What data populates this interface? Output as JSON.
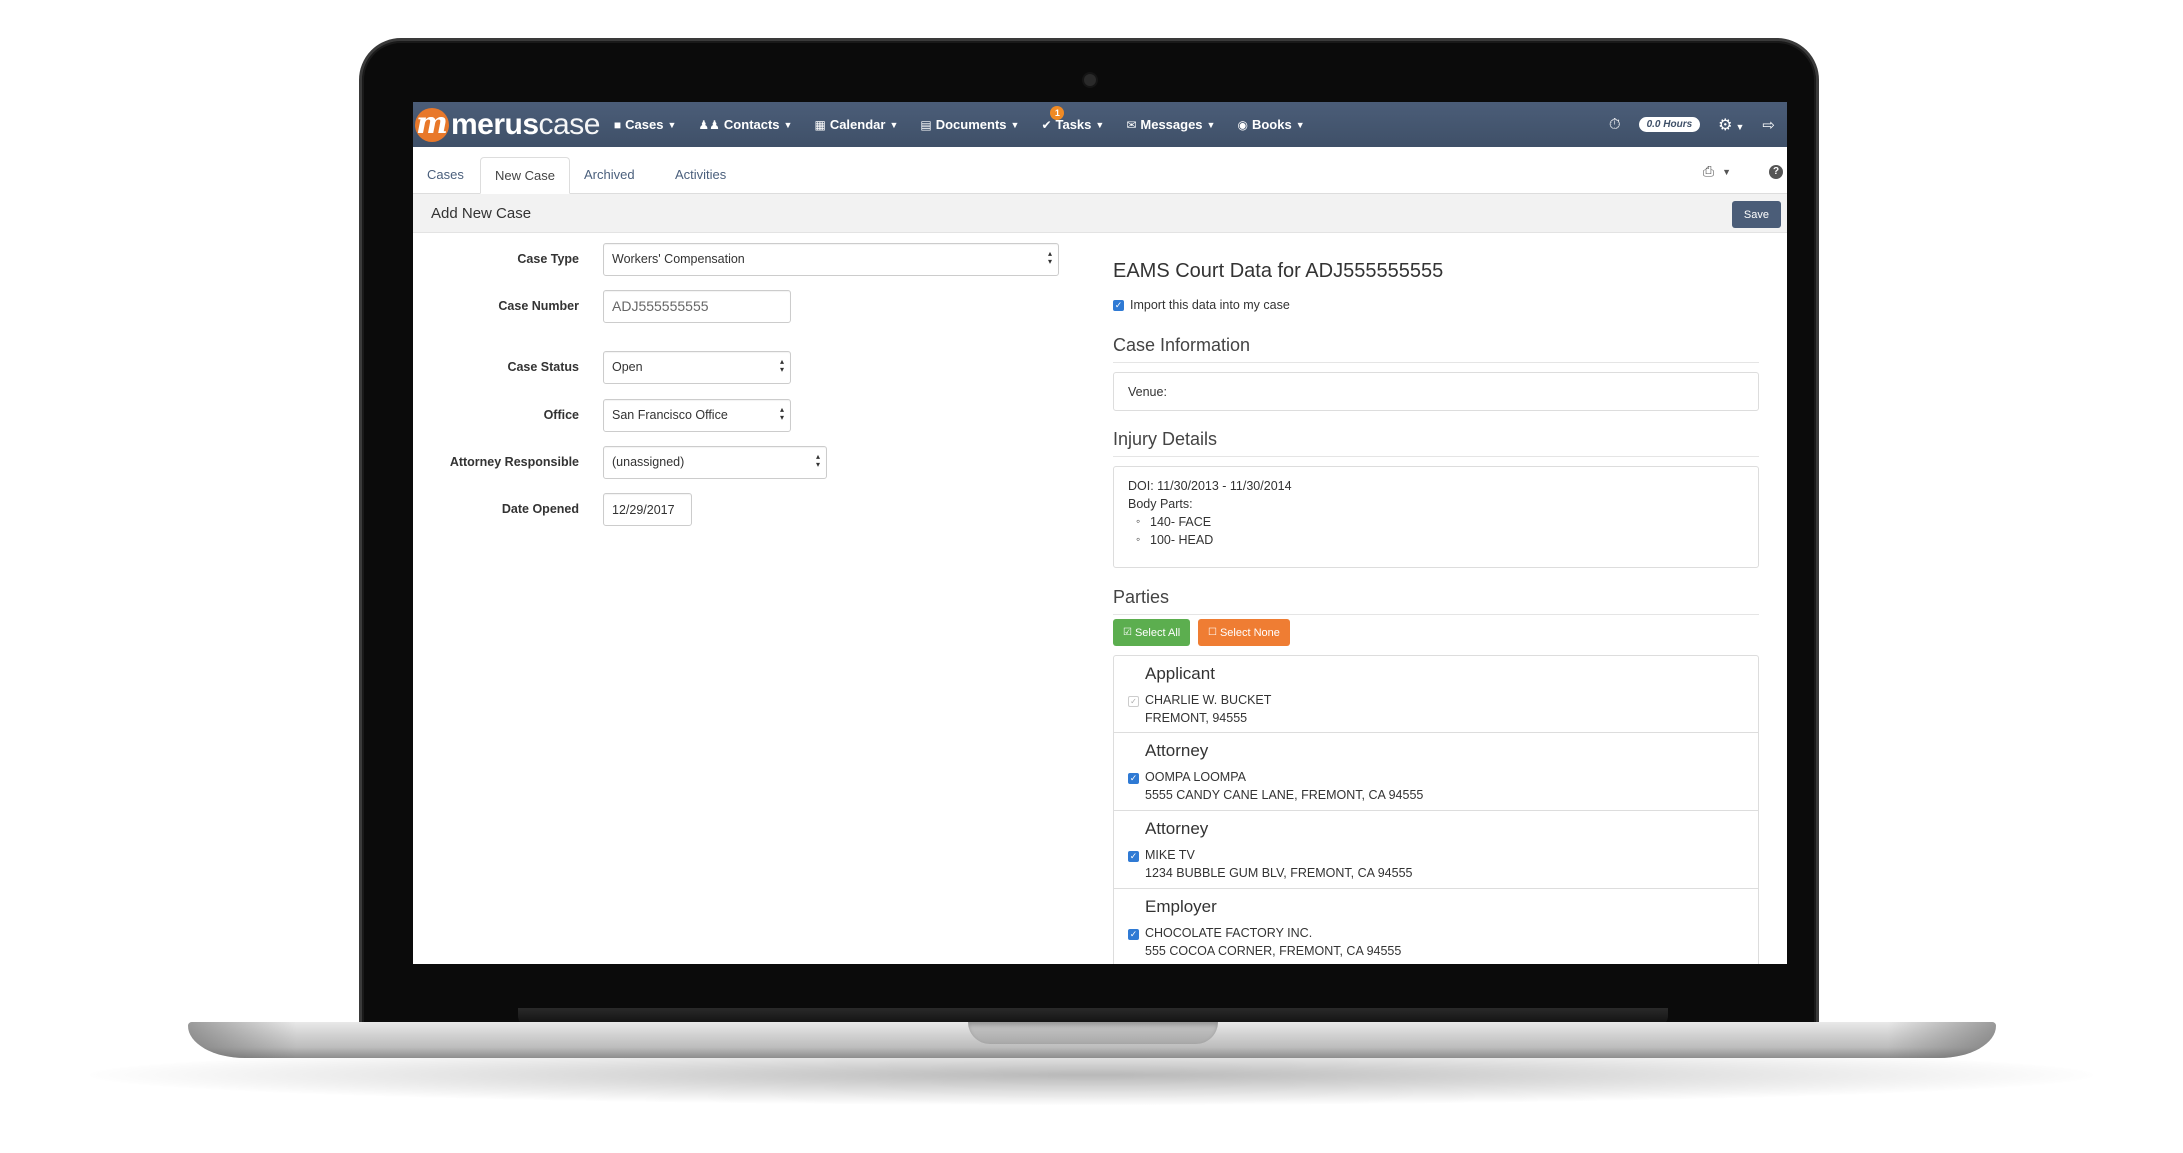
{
  "app": {
    "brand_part1": "merus",
    "brand_part2": "case",
    "accent_color": "#e8782a",
    "nav_color": "#4b5d78"
  },
  "nav": {
    "items": [
      {
        "label": "Cases",
        "icon": "briefcase-icon"
      },
      {
        "label": "Contacts",
        "icon": "people-icon"
      },
      {
        "label": "Calendar",
        "icon": "calendar-icon"
      },
      {
        "label": "Documents",
        "icon": "document-icon"
      },
      {
        "label": "Tasks",
        "icon": "check-circle-icon",
        "badge": "1"
      },
      {
        "label": "Messages",
        "icon": "envelope-icon"
      },
      {
        "label": "Books",
        "icon": "dollar-circle-icon"
      }
    ],
    "hours": "0.0 Hours"
  },
  "tabs": [
    {
      "label": "Cases"
    },
    {
      "label": "New Case"
    },
    {
      "label": "Archived"
    },
    {
      "label": "Activities"
    }
  ],
  "page": {
    "title": "Add New Case",
    "save_label": "Save"
  },
  "form": {
    "case_type": {
      "label": "Case Type",
      "value": "Workers' Compensation"
    },
    "case_number": {
      "label": "Case Number",
      "value": "ADJ555555555"
    },
    "case_status": {
      "label": "Case Status",
      "value": "Open"
    },
    "office": {
      "label": "Office",
      "value": "San Francisco Office"
    },
    "attorney": {
      "label": "Attorney Responsible",
      "value": "(unassigned)"
    },
    "date_opened": {
      "label": "Date Opened",
      "value": "12/29/2017"
    }
  },
  "eams": {
    "title": "EAMS Court Data for ADJ555555555",
    "import_label": "Import this data into my case",
    "case_info_heading": "Case Information",
    "venue": "Venue:",
    "injury_heading": "Injury Details",
    "doi": "DOI: 11/30/2013 - 11/30/2014",
    "body_parts_label": "Body Parts:",
    "body_parts": [
      "140- FACE",
      "100- HEAD"
    ],
    "parties_heading": "Parties",
    "select_all": "Select All",
    "select_none": "Select None",
    "parties": [
      {
        "role": "Applicant",
        "name": "CHARLIE W. BUCKET",
        "address": "FREMONT, 94555",
        "checked": "disabled"
      },
      {
        "role": "Attorney",
        "name": "OOMPA LOOMPA",
        "address": "5555 CANDY CANE LANE, FREMONT, CA 94555",
        "checked": "true"
      },
      {
        "role": "Attorney",
        "name": "MIKE TV",
        "address": "1234 BUBBLE GUM BLV, FREMONT, CA 94555",
        "checked": "true"
      },
      {
        "role": "Employer",
        "name": "CHOCOLATE FACTORY INC.",
        "address": "555 COCOA CORNER, FREMONT, CA 94555",
        "checked": "true"
      }
    ]
  }
}
